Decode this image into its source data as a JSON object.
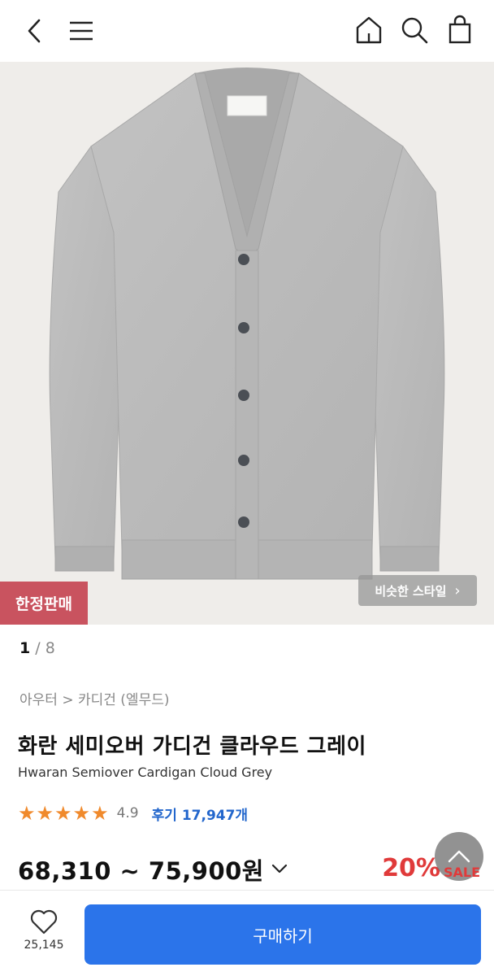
{
  "header": {
    "back_icon": "chevron-left-icon",
    "menu_icon": "hamburger-icon",
    "home_icon": "home-icon",
    "search_icon": "search-icon",
    "cart_icon": "shopping-bag-icon"
  },
  "hero": {
    "badge": "한정판매",
    "similar_style_label": "비슷한 스타일",
    "similar_chevron": "›"
  },
  "pager": {
    "current": "1",
    "separator": " / ",
    "total": "8"
  },
  "product": {
    "breadcrumb": "아우터 > 카디건 (엘무드)",
    "title": "화란 세미오버 가디건 클라우드 그레이",
    "subtitle": "Hwaran Semiover Cardigan Cloud Grey",
    "rating": "4.9",
    "rating_stars": 5,
    "reviews": "후기 17,947개",
    "price": "68,310 ~ 75,900원",
    "discount": "20%",
    "sale_label": "SALE"
  },
  "bottom": {
    "wish_count": "25,145",
    "buy_label": "구매하기"
  },
  "colors": {
    "accent_blue": "#2b74ea",
    "badge_red": "#c9535f",
    "discount_red": "#e03a3a",
    "star_orange": "#f08a2c"
  }
}
